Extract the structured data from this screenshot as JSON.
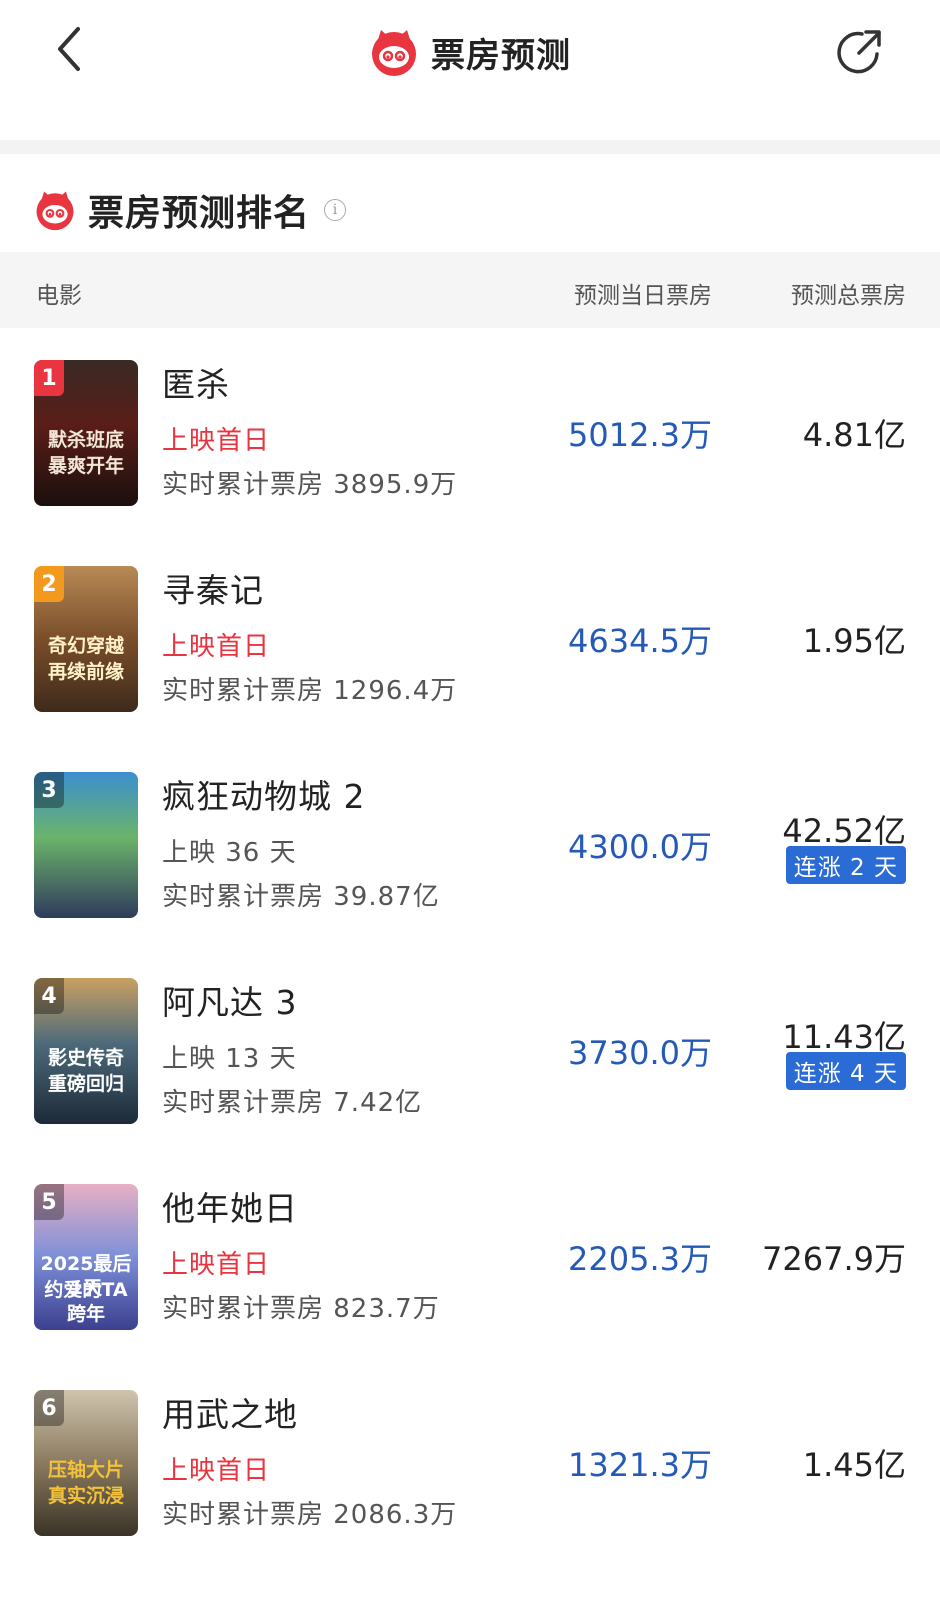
{
  "header": {
    "title": "票房预测"
  },
  "section": {
    "title": "票房预测排名",
    "info_icon": "i"
  },
  "table": {
    "col_movie": "电影",
    "col_daily": "预测当日票房",
    "col_total": "预测总票房"
  },
  "colors": {
    "accent_red": "#e8353f",
    "value_blue": "#2459b8",
    "badge_blue": "#2a6bd6"
  },
  "movies": [
    {
      "rank": "1",
      "name": "匿杀",
      "status": "上映首日",
      "status_red": true,
      "cumulative": "实时累计票房 3895.9万",
      "daily": "5012.3万",
      "total": "4.81亿",
      "badge": "",
      "poster_text": [
        "默杀班底",
        "暴爽开年"
      ]
    },
    {
      "rank": "2",
      "name": "寻秦记",
      "status": "上映首日",
      "status_red": true,
      "cumulative": "实时累计票房 1296.4万",
      "daily": "4634.5万",
      "total": "1.95亿",
      "badge": "",
      "poster_text": [
        "奇幻穿越",
        "再续前缘"
      ]
    },
    {
      "rank": "3",
      "name": "疯狂动物城 2",
      "status": "上映 36 天",
      "status_red": false,
      "cumulative": "实时累计票房 39.87亿",
      "daily": "4300.0万",
      "total": "42.52亿",
      "badge": "连涨 2 天",
      "poster_text": []
    },
    {
      "rank": "4",
      "name": "阿凡达 3",
      "status": "上映 13 天",
      "status_red": false,
      "cumulative": "实时累计票房 7.42亿",
      "daily": "3730.0万",
      "total": "11.43亿",
      "badge": "连涨 4 天",
      "poster_text": [
        "影史传奇",
        "重磅回归"
      ]
    },
    {
      "rank": "5",
      "name": "他年她日",
      "status": "上映首日",
      "status_red": true,
      "cumulative": "实时累计票房 823.7万",
      "daily": "2205.3万",
      "total": "7267.9万",
      "badge": "",
      "poster_text": [
        "2025最后1天",
        "约爱的TA跨年"
      ]
    },
    {
      "rank": "6",
      "name": "用武之地",
      "status": "上映首日",
      "status_red": true,
      "cumulative": "实时累计票房 2086.3万",
      "daily": "1321.3万",
      "total": "1.45亿",
      "badge": "",
      "poster_text": [
        "压轴大片",
        "真实沉浸"
      ]
    }
  ]
}
